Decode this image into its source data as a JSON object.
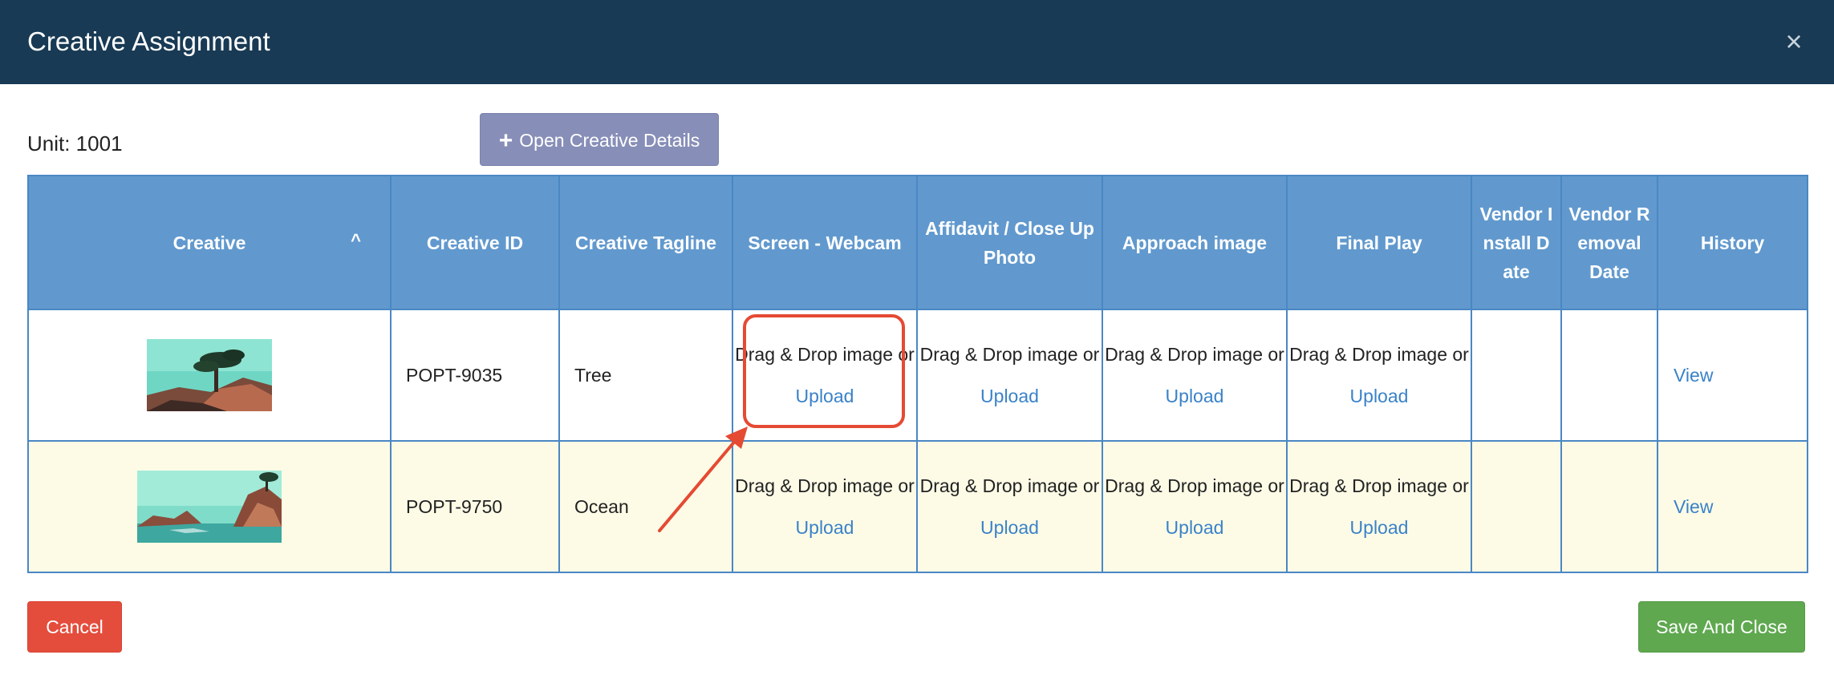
{
  "modal": {
    "title": "Creative Assignment",
    "close_label": "×"
  },
  "unit": {
    "label": "Unit: 1001"
  },
  "open_details": {
    "icon": "plus-icon",
    "label": "Open Creative Details"
  },
  "table": {
    "headers": {
      "creative": "Creative",
      "sort_indicator": "^",
      "creative_id": "Creative ID",
      "creative_tagline": "Creative Tagline",
      "screen_webcam": "Screen - Webcam",
      "affidavit": "Affidavit / Close Up Photo",
      "approach_image": "Approach image",
      "final_play": "Final Play",
      "vendor_install_date": "Vendor Install Date",
      "vendor_removal_date": "Vendor Removal Date",
      "history": "History"
    },
    "drop_text": "Drag & Drop image or",
    "upload_label": "Upload",
    "view_label": "View",
    "rows": [
      {
        "creative_image": "tree-creative-thumbnail",
        "creative_id": "POPT-9035",
        "tagline": "Tree",
        "vendor_install_date": "",
        "vendor_removal_date": ""
      },
      {
        "creative_image": "ocean-creative-thumbnail",
        "creative_id": "POPT-9750",
        "tagline": "Ocean",
        "vendor_install_date": "",
        "vendor_removal_date": ""
      }
    ]
  },
  "footer": {
    "cancel_label": "Cancel",
    "save_label": "Save And Close"
  },
  "colors": {
    "header_bg": "#183a54",
    "table_header_bg": "#6199ce",
    "alt_row_bg": "#fdfbe6",
    "link": "#3a82c8",
    "cancel_bg": "#e44d3c",
    "save_bg": "#5fa84f",
    "open_details_bg": "#878eb8",
    "annotation": "#e54a33"
  }
}
